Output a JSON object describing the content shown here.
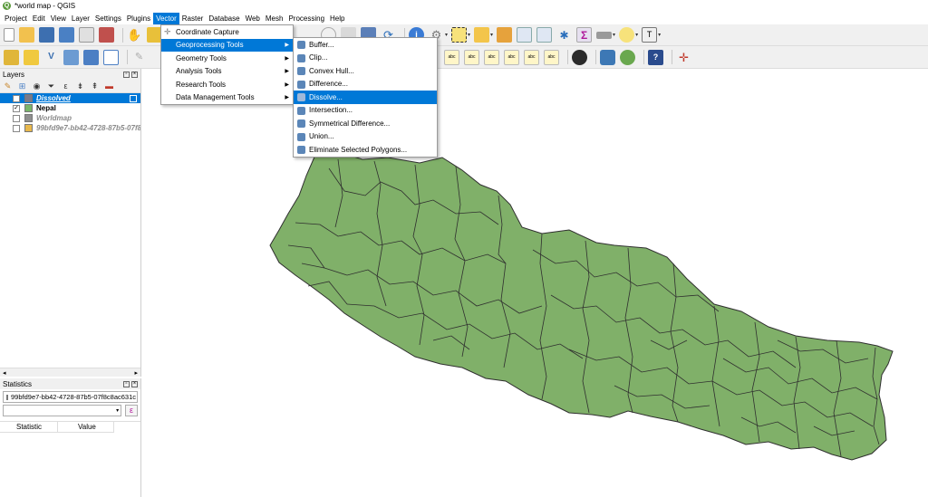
{
  "window": {
    "title": "*world map - QGIS"
  },
  "menubar": {
    "items": [
      "Project",
      "Edit",
      "View",
      "Layer",
      "Settings",
      "Plugins",
      "Vector",
      "Raster",
      "Database",
      "Web",
      "Mesh",
      "Processing",
      "Help"
    ],
    "active": "Vector"
  },
  "vector_menu": {
    "items": [
      {
        "label": "Coordinate Capture",
        "submenu": false
      },
      {
        "label": "Geoprocessing Tools",
        "submenu": true
      },
      {
        "label": "Geometry Tools",
        "submenu": true
      },
      {
        "label": "Analysis Tools",
        "submenu": true
      },
      {
        "label": "Research Tools",
        "submenu": true
      },
      {
        "label": "Data Management Tools",
        "submenu": true
      }
    ],
    "highlighted": "Geoprocessing Tools"
  },
  "geoprocessing_menu": {
    "items": [
      "Buffer...",
      "Clip...",
      "Convex Hull...",
      "Difference...",
      "Dissolve...",
      "Intersection...",
      "Symmetrical Difference...",
      "Union...",
      "Eliminate Selected Polygons..."
    ],
    "highlighted": "Dissolve..."
  },
  "layers_panel": {
    "title": "Layers",
    "layers": [
      {
        "name": "Dissolved",
        "checked": false,
        "color": "#7a7a8a",
        "selected": true
      },
      {
        "name": "Nepal",
        "checked": true,
        "color": "#79b56a",
        "selected": false
      },
      {
        "name": "Worldmap",
        "checked": false,
        "color": "#8f8f8f",
        "selected": false
      },
      {
        "name": "99bfd9e7-bb42-4728-87b5-07f8...",
        "checked": false,
        "color": "#e8b84c",
        "selected": false
      }
    ]
  },
  "statistics_panel": {
    "title": "Statistics",
    "layer_select": "99bfd9e7-bb42-4728-87b5-07f8c8ac631c",
    "columns": [
      "Statistic",
      "Value"
    ]
  },
  "map": {
    "fill": "#80b069",
    "stroke": "#2f2f2f"
  }
}
